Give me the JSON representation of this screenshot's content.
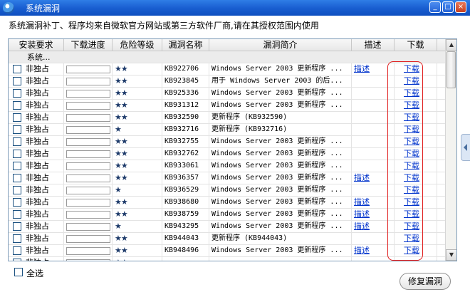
{
  "window": {
    "title": "系统漏洞",
    "minimize": "_",
    "maximize": "□",
    "close": "×"
  },
  "description": "系统漏洞补丁、程序均来自微软官方网站或第三方软件厂商,请在其授权范围内使用",
  "table": {
    "columns": [
      "安装要求",
      "下载进度",
      "危险等级",
      "漏洞名称",
      "漏洞简介",
      "描述",
      "下载"
    ],
    "group_label": "系统...",
    "rows": [
      {
        "req": "非独占",
        "stars": "★★",
        "kb": "KB922706",
        "intro": "Windows Server 2003 更新程序 ...",
        "desc": "描述",
        "dl": "下载"
      },
      {
        "req": "非独占",
        "stars": "★★",
        "kb": "KB923845",
        "intro": "用于 Windows Server 2003 的后...",
        "desc": "",
        "dl": "下载"
      },
      {
        "req": "非独占",
        "stars": "★★",
        "kb": "KB925336",
        "intro": "Windows Server 2003 更新程序 ...",
        "desc": "",
        "dl": "下载"
      },
      {
        "req": "非独占",
        "stars": "★★",
        "kb": "KB931312",
        "intro": "Windows Server 2003 更新程序 ...",
        "desc": "",
        "dl": "下载"
      },
      {
        "req": "非独占",
        "stars": "★★",
        "kb": "KB932590",
        "intro": "更新程序 (KB932590)",
        "desc": "",
        "dl": "下载"
      },
      {
        "req": "非独占",
        "stars": "★",
        "kb": "KB932716",
        "intro": "更新程序 (KB932716)",
        "desc": "",
        "dl": "下载"
      },
      {
        "req": "非独占",
        "stars": "★★",
        "kb": "KB932755",
        "intro": "Windows Server 2003 更新程序 ...",
        "desc": "",
        "dl": "下载"
      },
      {
        "req": "非独占",
        "stars": "★★",
        "kb": "KB932762",
        "intro": "Windows Server 2003 更新程序 ...",
        "desc": "",
        "dl": "下载"
      },
      {
        "req": "非独占",
        "stars": "★★",
        "kb": "KB933061",
        "intro": "Windows Server 2003 更新程序 ...",
        "desc": "",
        "dl": "下载"
      },
      {
        "req": "非独占",
        "stars": "★★",
        "kb": "KB936357",
        "intro": "Windows Server 2003 更新程序 ...",
        "desc": "描述",
        "dl": "下载"
      },
      {
        "req": "非独占",
        "stars": "★",
        "kb": "KB936529",
        "intro": "Windows Server 2003 更新程序 ...",
        "desc": "",
        "dl": "下载"
      },
      {
        "req": "非独占",
        "stars": "★★",
        "kb": "KB938680",
        "intro": "Windows Server 2003 更新程序 ...",
        "desc": "描述",
        "dl": "下载"
      },
      {
        "req": "非独占",
        "stars": "★★",
        "kb": "KB938759",
        "intro": "Windows Server 2003 更新程序 ...",
        "desc": "描述",
        "dl": "下载"
      },
      {
        "req": "非独占",
        "stars": "★",
        "kb": "KB943295",
        "intro": "Windows Server 2003 更新程序 ...",
        "desc": "描述",
        "dl": "下载"
      },
      {
        "req": "非独占",
        "stars": "★★",
        "kb": "KB944043",
        "intro": "更新程序 (KB944043)",
        "desc": "",
        "dl": "下载"
      },
      {
        "req": "非独占",
        "stars": "★★",
        "kb": "KB948496",
        "intro": "Windows Server 2003 更新程序 ...",
        "desc": "描述",
        "dl": "下载"
      },
      {
        "req": "非独占",
        "stars": "★★",
        "kb": "",
        "intro": "",
        "desc": "",
        "dl": ""
      }
    ]
  },
  "footer": {
    "select_all": "全选",
    "repair_button": "修复漏洞"
  },
  "icons": {
    "scroll_up": "▲",
    "scroll_down": "▼",
    "side_tab": "chevron-left-icon"
  }
}
